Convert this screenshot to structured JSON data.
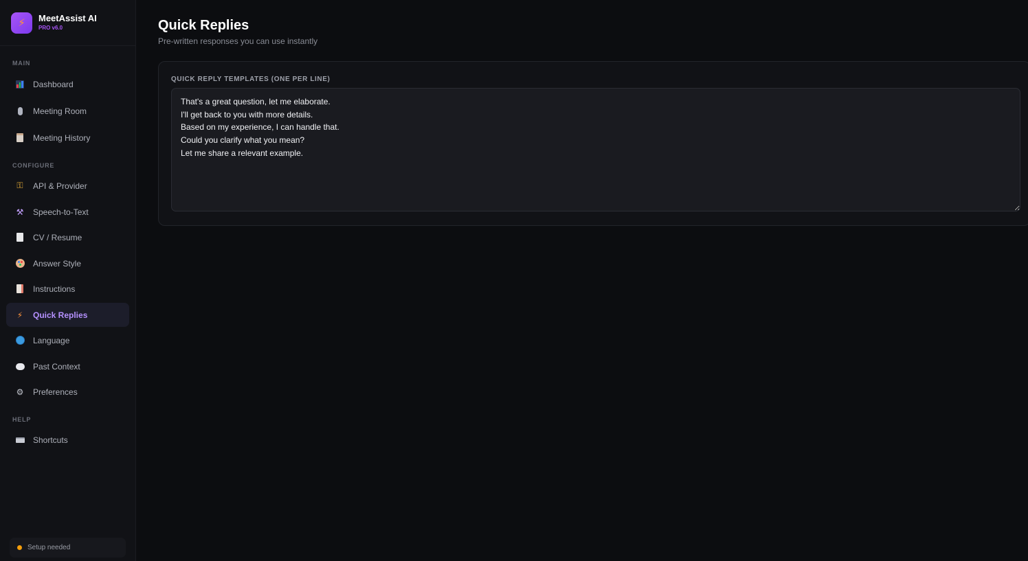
{
  "brand": {
    "name": "MeetAssist AI",
    "version": "PRO v6.0",
    "logo_icon": "lightning-bolt-icon"
  },
  "sidebar": {
    "sections": [
      {
        "label": "MAIN",
        "items": [
          {
            "label": "Dashboard",
            "icon": "bar-chart-icon"
          },
          {
            "label": "Meeting Room",
            "icon": "microphone-icon"
          },
          {
            "label": "Meeting History",
            "icon": "clipboard-icon"
          }
        ]
      },
      {
        "label": "CONFIGURE",
        "items": [
          {
            "label": "API & Provider",
            "icon": "key-icon"
          },
          {
            "label": "Speech-to-Text",
            "icon": "hammer-icon"
          },
          {
            "label": "CV / Resume",
            "icon": "document-icon"
          },
          {
            "label": "Answer Style",
            "icon": "palette-icon"
          },
          {
            "label": "Instructions",
            "icon": "memo-icon"
          },
          {
            "label": "Quick Replies",
            "icon": "lightning-bolt-icon",
            "active": true
          },
          {
            "label": "Language",
            "icon": "globe-icon"
          },
          {
            "label": "Past Context",
            "icon": "speech-bubble-icon"
          },
          {
            "label": "Preferences",
            "icon": "gear-icon"
          }
        ]
      },
      {
        "label": "HELP",
        "items": [
          {
            "label": "Shortcuts",
            "icon": "keyboard-icon"
          }
        ]
      }
    ],
    "status": {
      "text": "Setup needed",
      "color": "#f59e0b"
    }
  },
  "main": {
    "title": "Quick Replies",
    "subtitle": "Pre-written responses you can use instantly",
    "card": {
      "label": "QUICK REPLY TEMPLATES (ONE PER LINE)",
      "templates": "That's a great question, let me elaborate.\nI'll get back to you with more details.\nBased on my experience, I can handle that.\nCould you clarify what you mean?\nLet me share a relevant example."
    }
  },
  "colors": {
    "accent": "#a855f7",
    "active_text": "#b591ff",
    "background": "#0c0d10",
    "sidebar": "#111216"
  }
}
